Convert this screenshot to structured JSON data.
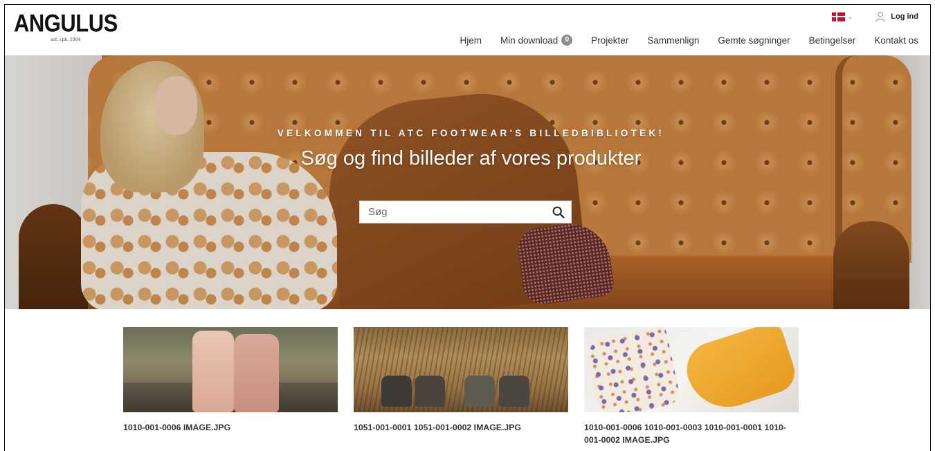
{
  "brand": {
    "name": "ANGULUS",
    "tagline": "est. cph. 1904"
  },
  "topbar": {
    "language_flag": "danish-flag-icon",
    "login_label": "Log ind"
  },
  "nav": {
    "items": [
      {
        "label": "Hjem"
      },
      {
        "label": "Min download",
        "badge": "0"
      },
      {
        "label": "Projekter"
      },
      {
        "label": "Sammenlign"
      },
      {
        "label": "Gemte søgninger"
      },
      {
        "label": "Betingelser"
      },
      {
        "label": "Kontakt os"
      }
    ]
  },
  "hero": {
    "kicker": "VELKOMMEN TIL ATC FOOTWEAR'S BILLEDBIBLIOTEK!",
    "title": "Søg og find billeder af vores produkter",
    "search_placeholder": "Søg"
  },
  "cards": [
    {
      "title": "1010-001-0006 IMAGE.JPG"
    },
    {
      "title": "1051-001-0001 1051-001-0002 IMAGE.JPG"
    },
    {
      "title": "1010-001-0006 1010-001-0003 1010-001-0001 1010-001-0002 IMAGE.JPG"
    }
  ],
  "colors": {
    "accent_flag_red": "#c8102e",
    "badge_gray": "#8e8e8e",
    "text_dark": "#333333"
  }
}
